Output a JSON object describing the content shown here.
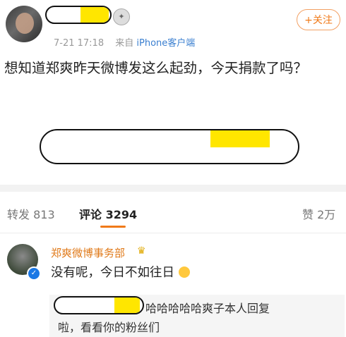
{
  "post": {
    "meta": {
      "time": "7-21 17:18",
      "source_prefix": "来自",
      "source": "iPhone客户端"
    },
    "follow_label": "+关注",
    "text": "想知道郑爽昨天微博发这么起劲，今天捐款了吗？"
  },
  "tabs": {
    "repost": "转发 813",
    "comment": "评论 3294",
    "like": "赞 2万"
  },
  "comment": {
    "author": "郑爽微博事务部",
    "text": "没有呢，今日不如往日",
    "reply_line1": "哈哈哈哈哈爽子本人回复",
    "reply_line2": "啦，看看你的粉丝们"
  },
  "colors": {
    "accent": "#f07a19",
    "link": "#3a7fd0",
    "redaction_fill": "#f7d7b8",
    "redaction_highlight": "#ffe600"
  },
  "icons": [
    "vip-badge-icon",
    "verified-icon",
    "crown-icon",
    "sweat-emoji-icon"
  ]
}
